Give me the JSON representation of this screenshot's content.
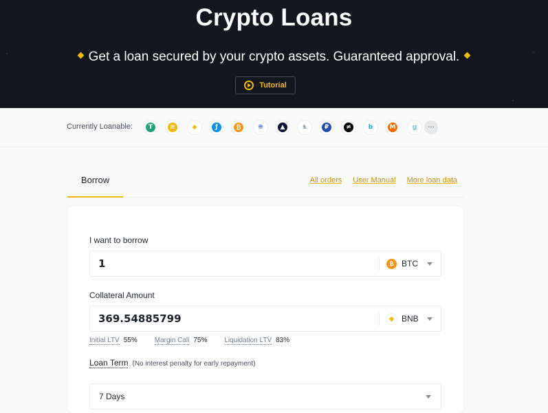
{
  "hero": {
    "title": "Crypto Loans",
    "subtitle": "Get a loan secured by your crypto assets. Guaranteed approval.",
    "tutorial_label": "Tutorial"
  },
  "loanable": {
    "label": "Currently Loanable:",
    "coins": [
      {
        "name": "USDT",
        "icon": "tether-icon",
        "color": "#26a17b",
        "glyph": "T"
      },
      {
        "name": "BUSD",
        "icon": "busd-icon",
        "color": "#f0b90b",
        "glyph": "≋"
      },
      {
        "name": "BNB",
        "icon": "bnb-icon",
        "color": "#ffffff",
        "glyph": "◆"
      },
      {
        "name": "FIL",
        "icon": "filecoin-icon",
        "color": "#0090ff",
        "glyph": "ƒ"
      },
      {
        "name": "BTC",
        "icon": "bitcoin-icon",
        "color": "#f7931a",
        "glyph": "₿"
      },
      {
        "name": "HBAR",
        "icon": "network-icon",
        "color": "#ffffff",
        "glyph": "⁜"
      },
      {
        "name": "MNT",
        "icon": "mountain-icon",
        "color": "#0b1536",
        "glyph": "▲"
      },
      {
        "name": "1INCH",
        "icon": "unicorn-icon",
        "color": "#ffffff",
        "glyph": "♞"
      },
      {
        "name": "USDP",
        "icon": "paxos-icon",
        "color": "#2350b0",
        "glyph": "₽"
      },
      {
        "name": "AKRO",
        "icon": "wing-icon",
        "color": "#000000",
        "glyph": "≠"
      },
      {
        "name": "BAND",
        "icon": "flame-icon",
        "color": "#ffffff",
        "glyph": "b"
      },
      {
        "name": "XMR",
        "icon": "monero-icon",
        "color": "#ff6600",
        "glyph": "M"
      },
      {
        "name": "GRT",
        "icon": "graph-icon",
        "color": "#ffffff",
        "glyph": "g"
      }
    ],
    "more_label": "···"
  },
  "tabs": {
    "borrow": "Borrow",
    "links": [
      "All orders",
      "User Manual",
      "More loan data"
    ]
  },
  "form": {
    "borrow_label": "I want to borrow",
    "borrow_value": "1",
    "borrow_asset": "BTC",
    "borrow_asset_color": "#f7931a",
    "collateral_label": "Collateral Amount",
    "collateral_value": "369.54885799",
    "collateral_asset": "BNB",
    "collateral_asset_color": "#f0b90b",
    "ltv": [
      {
        "key": "Initial LTV",
        "value": "55%"
      },
      {
        "key": "Margin Call",
        "value": "75%"
      },
      {
        "key": "Liquidation LTV",
        "value": "83%"
      }
    ],
    "term_label": "Loan Term",
    "term_note": "(No interest penalty for early repayment)",
    "term_value": "7 Days"
  },
  "colors": {
    "brand": "#f0b90b",
    "hero_bg": "#13161f"
  }
}
